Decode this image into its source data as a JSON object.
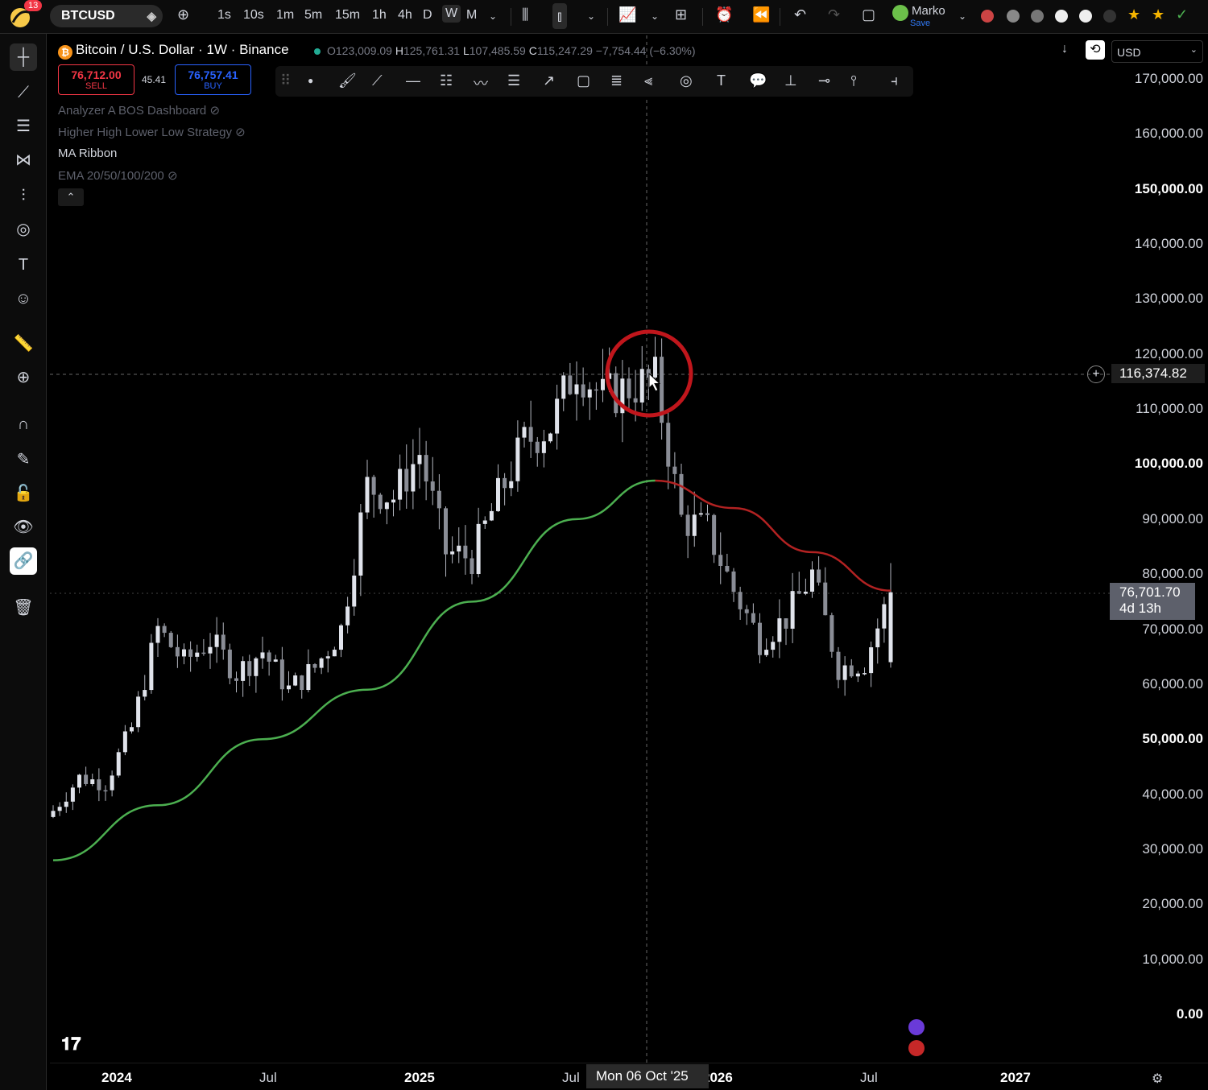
{
  "topbar": {
    "badge": "13",
    "symbol": "BTCUSD",
    "intervals": [
      "1s",
      "10s",
      "1m",
      "5m",
      "15m",
      "1h",
      "4h",
      "D",
      "W",
      "M"
    ],
    "active_interval": "W",
    "user_name": "Marko",
    "user_save": "Save"
  },
  "legend": {
    "title": "Bitcoin / U.S. Dollar · 1W · Binance",
    "btc_icon": "₿",
    "o_label": "O",
    "o": "123,009.09",
    "h_label": "H",
    "h": "125,761.31",
    "l_label": "L",
    "l": "107,485.59",
    "c_label": "C",
    "c": "115,247.29",
    "change": "−7,754.44 (−6.30%)"
  },
  "trade": {
    "sell_price": "76,712.00",
    "sell_label": "SELL",
    "spread": "45.41",
    "buy_price": "76,757.41",
    "buy_label": "BUY"
  },
  "indicators": [
    {
      "name": "Analyzer A BOS Dashboard",
      "visible": false
    },
    {
      "name": "Higher High Lower Low Strategy",
      "visible": false
    },
    {
      "name": "MA Ribbon",
      "visible": true
    },
    {
      "name": "EMA 20/50/100/200",
      "visible": false
    }
  ],
  "currency": "USD",
  "crosshair_price": "116,374.82",
  "last_price": "76,701.70",
  "countdown": "4d 13h",
  "crosshair_date": "Mon 06 Oct '25",
  "price_axis": [
    {
      "v": 170000,
      "t": "170,000.00",
      "bold": false
    },
    {
      "v": 160000,
      "t": "160,000.00",
      "bold": false
    },
    {
      "v": 150000,
      "t": "150,000.00",
      "bold": true
    },
    {
      "v": 140000,
      "t": "140,000.00",
      "bold": false
    },
    {
      "v": 130000,
      "t": "130,000.00",
      "bold": false
    },
    {
      "v": 120000,
      "t": "120,000.00",
      "bold": false
    },
    {
      "v": 110000,
      "t": "110,000.00",
      "bold": false
    },
    {
      "v": 100000,
      "t": "100,000.00",
      "bold": true
    },
    {
      "v": 90000,
      "t": "90,000.00",
      "bold": false
    },
    {
      "v": 80000,
      "t": "80,000.00",
      "bold": false
    },
    {
      "v": 70000,
      "t": "70,000.00",
      "bold": false
    },
    {
      "v": 60000,
      "t": "60,000.00",
      "bold": false
    },
    {
      "v": 50000,
      "t": "50,000.00",
      "bold": true
    },
    {
      "v": 40000,
      "t": "40,000.00",
      "bold": false
    },
    {
      "v": 30000,
      "t": "30,000.00",
      "bold": false
    },
    {
      "v": 20000,
      "t": "20,000.00",
      "bold": false
    },
    {
      "v": 10000,
      "t": "10,000.00",
      "bold": false
    },
    {
      "v": 0,
      "t": "0.00",
      "bold": true
    }
  ],
  "time_axis": [
    {
      "t": "2024",
      "bold": true
    },
    {
      "t": "Jul",
      "bold": false
    },
    {
      "t": "2025",
      "bold": true
    },
    {
      "t": "Jul",
      "bold": false
    },
    {
      "t": "2026",
      "bold": true
    },
    {
      "t": "Jul",
      "bold": false
    },
    {
      "t": "2027",
      "bold": true
    }
  ],
  "colors": {
    "up_candle": "#d1d4dc",
    "ma_green": "#4caf50",
    "ma_red": "#b22222",
    "highlight_circle": "#c0161c",
    "sell": "#f23645",
    "buy": "#2962ff"
  },
  "chart_data": {
    "type": "candlestick",
    "title": "Bitcoin / U.S. Dollar · 1W · Binance",
    "ylim": [
      0,
      170000
    ],
    "weekly_close_path": [
      [
        "2023-11",
        37000
      ],
      [
        "2023-12",
        43000
      ],
      [
        "2024-01",
        42000
      ],
      [
        "2024-02",
        52000
      ],
      [
        "2024-03",
        70000
      ],
      [
        "2024-04",
        64000
      ],
      [
        "2024-05",
        68000
      ],
      [
        "2024-06",
        62000
      ],
      [
        "2024-07",
        66000
      ],
      [
        "2024-08",
        59000
      ],
      [
        "2024-09",
        63000
      ],
      [
        "2024-10",
        70000
      ],
      [
        "2024-11",
        96000
      ],
      [
        "2024-12",
        94000
      ],
      [
        "2025-01",
        102000
      ],
      [
        "2025-02",
        84000
      ],
      [
        "2025-03",
        83000
      ],
      [
        "2025-04",
        94000
      ],
      [
        "2025-05",
        104000
      ],
      [
        "2025-06",
        107000
      ],
      [
        "2025-07",
        118000
      ],
      [
        "2025-08",
        112000
      ],
      [
        "2025-09",
        114000
      ],
      [
        "2025-10",
        115247
      ],
      [
        "2025-11",
        90000
      ],
      [
        "2025-12",
        88000
      ],
      [
        "2026-01",
        77000
      ],
      [
        "2026-02",
        68000
      ],
      [
        "2026-03",
        72000
      ],
      [
        "2026-04",
        80000
      ],
      [
        "2026-05",
        63000
      ],
      [
        "2026-06",
        64000
      ],
      [
        "2026-07",
        76701
      ]
    ],
    "ma_ribbon": [
      [
        "2023-11",
        28000
      ],
      [
        "2024-03",
        38000
      ],
      [
        "2024-07",
        50000
      ],
      [
        "2024-11",
        59000
      ],
      [
        "2025-03",
        75000
      ],
      [
        "2025-07",
        90000
      ],
      [
        "2025-10",
        97000
      ],
      [
        "2026-01",
        92000
      ],
      [
        "2026-04",
        84000
      ],
      [
        "2026-07",
        77000
      ]
    ]
  }
}
